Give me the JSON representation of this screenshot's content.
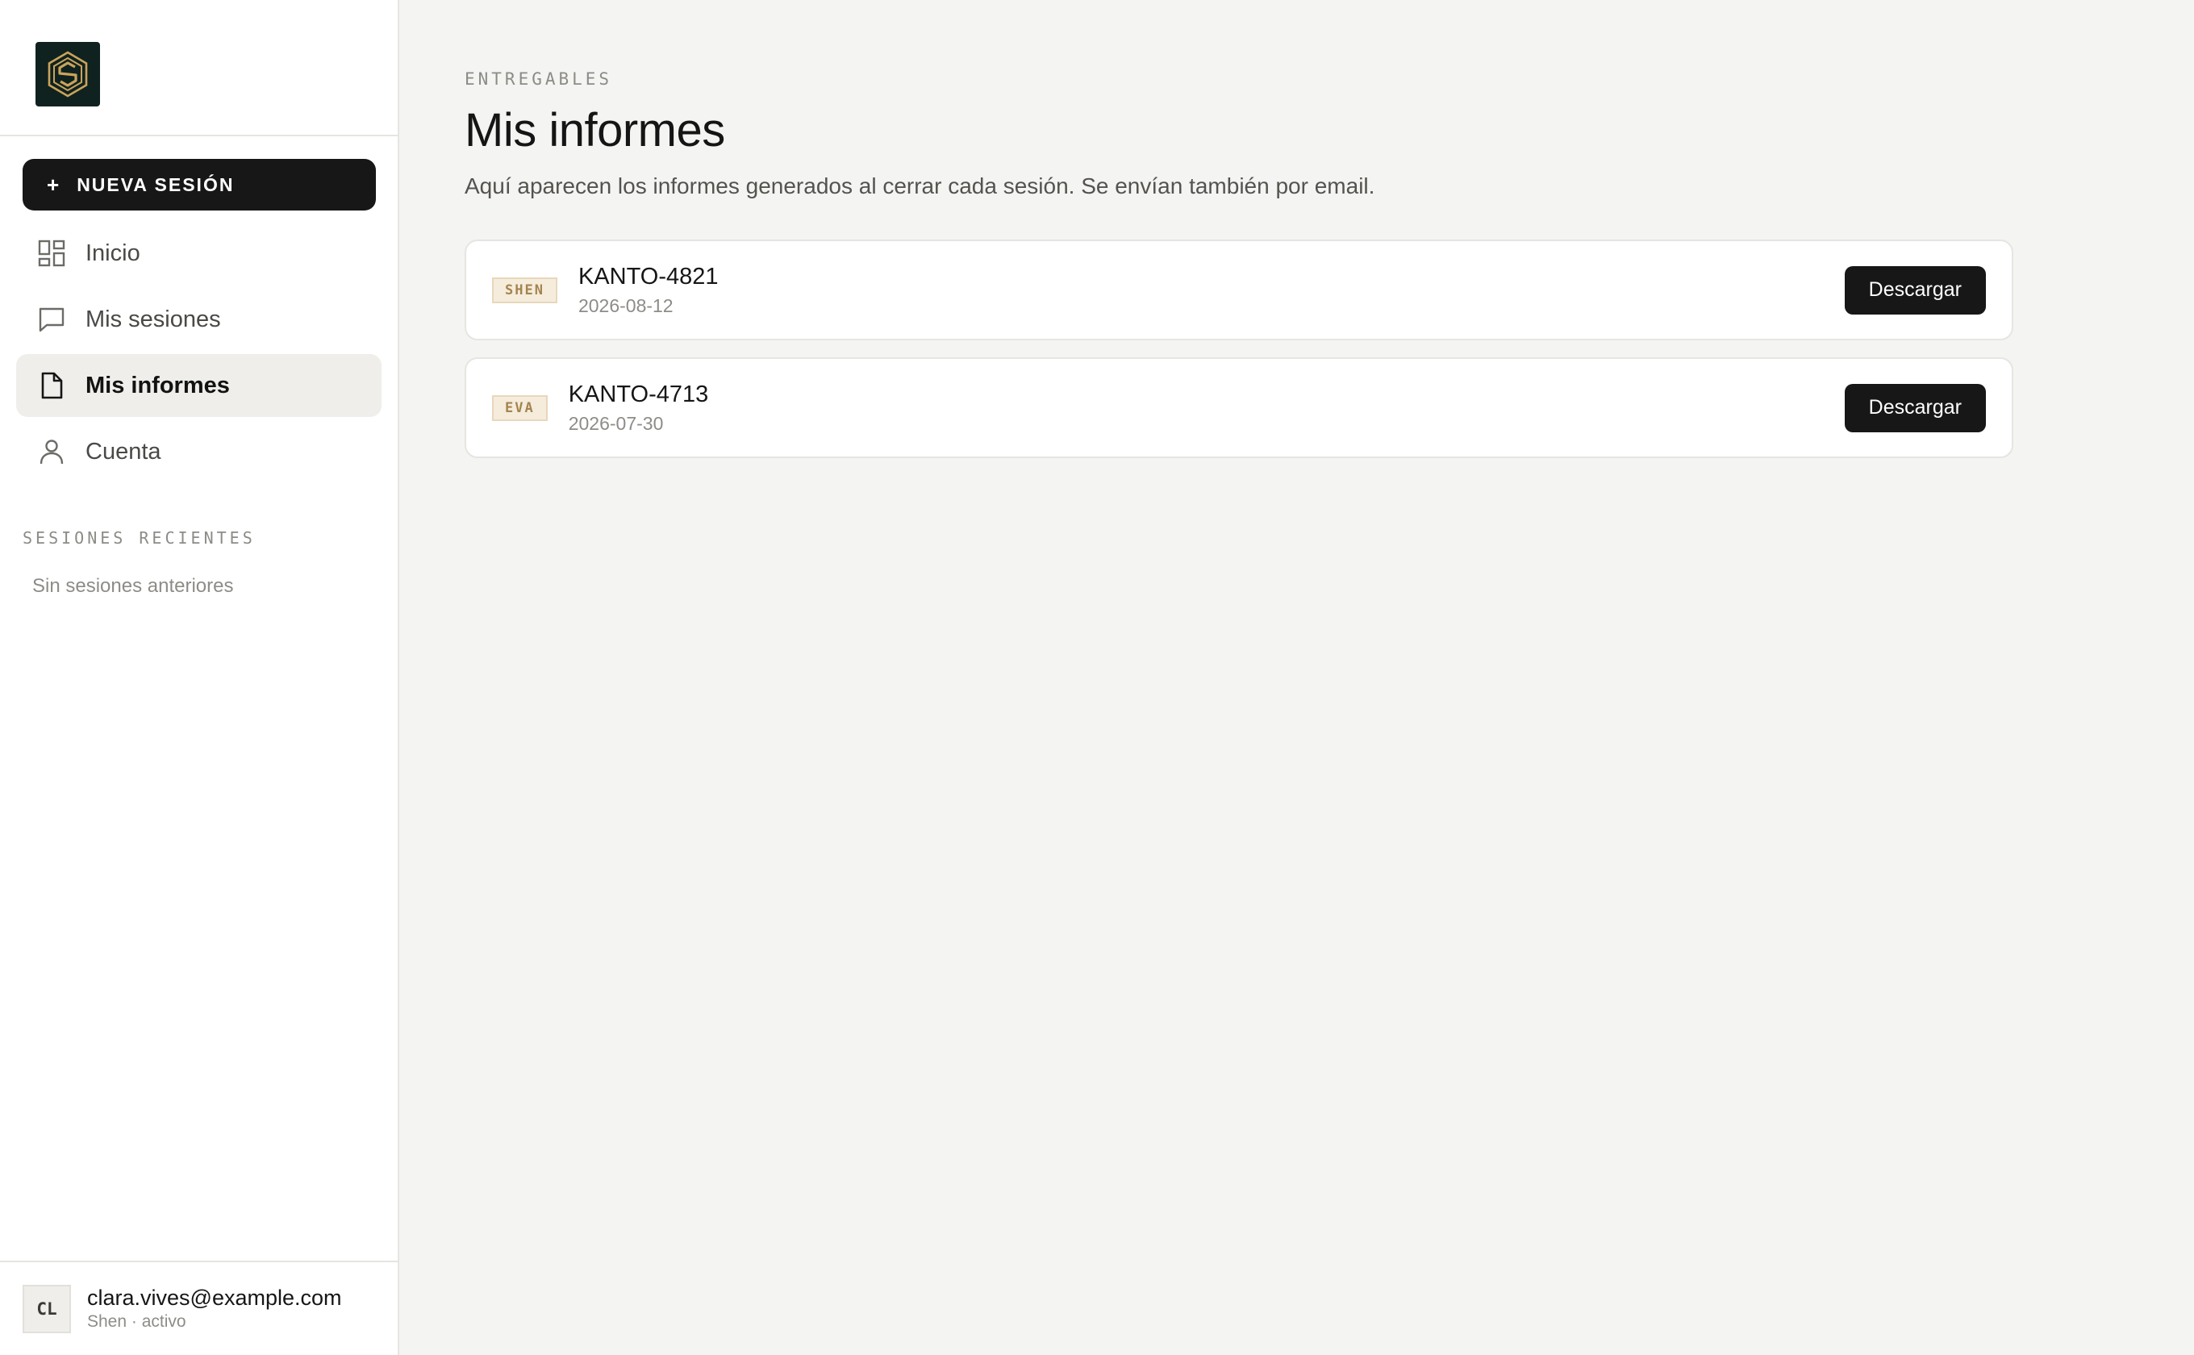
{
  "sidebar": {
    "new_session_label": "NUEVA SESIÓN",
    "nav": [
      {
        "label": "Inicio",
        "icon": "dashboard-icon"
      },
      {
        "label": "Mis sesiones",
        "icon": "chat-icon"
      },
      {
        "label": "Mis informes",
        "icon": "document-icon",
        "active": true
      },
      {
        "label": "Cuenta",
        "icon": "user-icon"
      }
    ],
    "recent_label": "SESIONES RECIENTES",
    "recent_empty": "Sin sesiones anteriores",
    "user": {
      "initials": "CL",
      "email": "clara.vives@example.com",
      "status": "Shen · activo"
    }
  },
  "main": {
    "eyebrow": "ENTREGABLES",
    "title": "Mis informes",
    "subtitle": "Aquí aparecen los informes generados al cerrar cada sesión. Se envían también por email.",
    "reports": [
      {
        "tag": "SHEN",
        "name": "KANTO-4821",
        "date": "2026-08-12",
        "action": "Descargar"
      },
      {
        "tag": "EVA",
        "name": "KANTO-4713",
        "date": "2026-07-30",
        "action": "Descargar"
      }
    ]
  },
  "colors": {
    "accent_dark": "#171717",
    "tag_text": "#a4844f",
    "tag_bg": "#f6ecdc",
    "logo_bg": "#10221f",
    "logo_gold": "#c9a45c"
  }
}
